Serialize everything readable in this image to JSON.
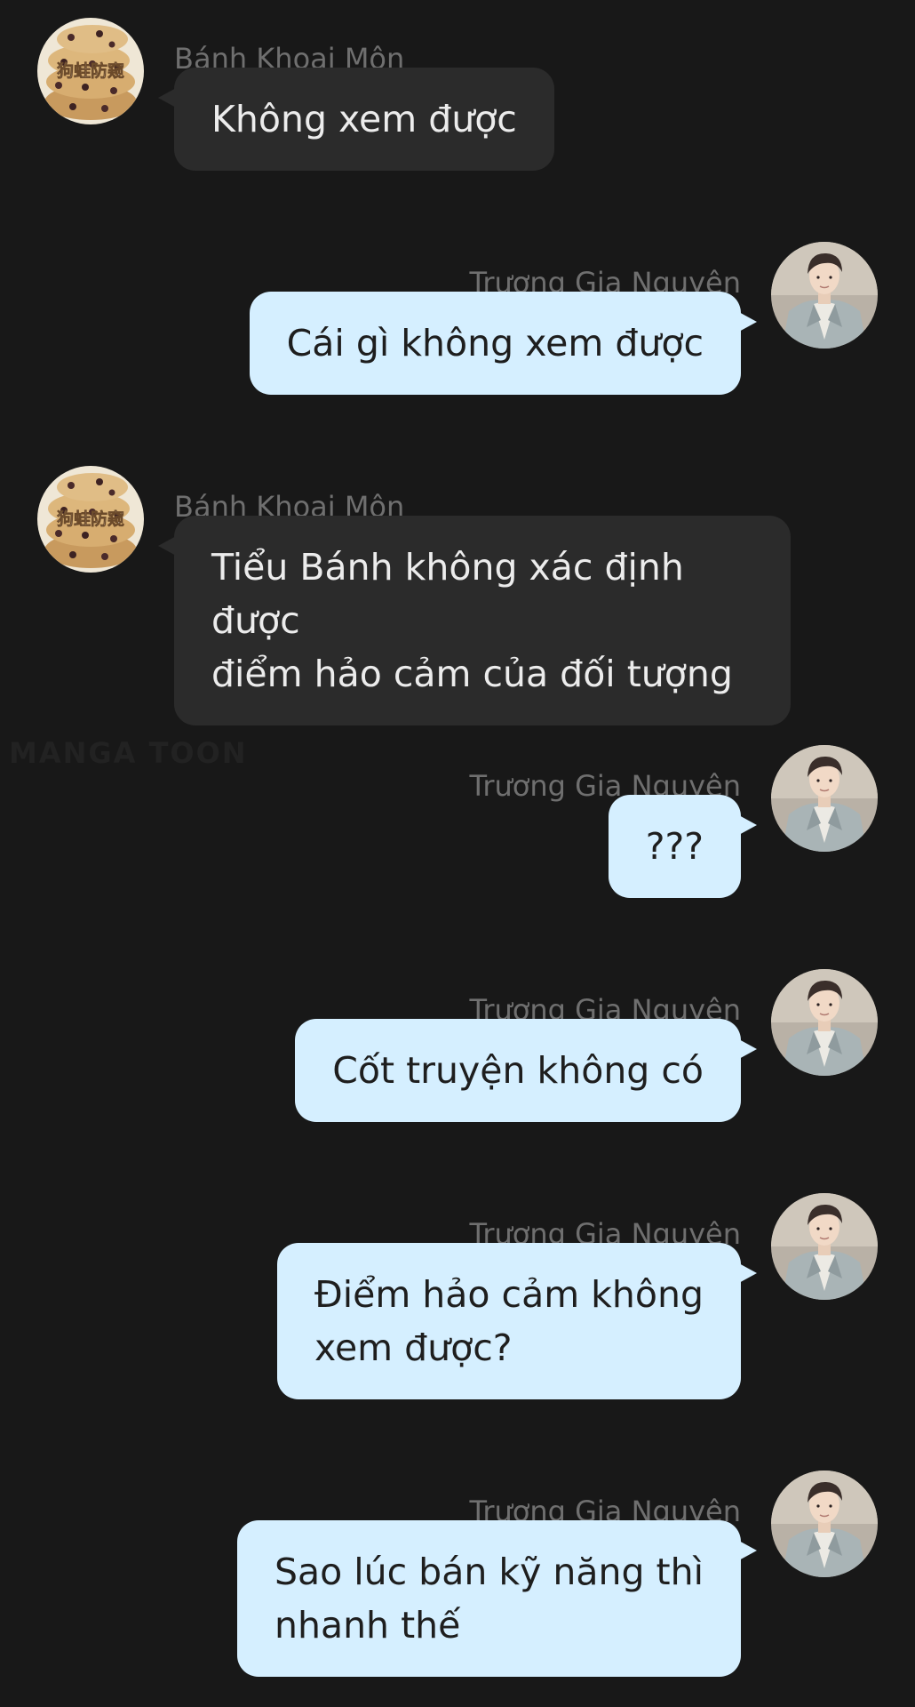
{
  "participants": {
    "left": {
      "name": "Bánh Khoai Môn",
      "avatar_icon": "cookie-stack-avatar"
    },
    "right": {
      "name": "Trương Gia Nguyên",
      "avatar_icon": "man-in-suit-avatar"
    }
  },
  "colors": {
    "background": "#181818",
    "left_bubble": "#2b2b2b",
    "right_bubble": "#d5efff",
    "sender_name": "#6f6f6f"
  },
  "avatar_text": "狗蛙防窥",
  "watermark": "MANGA TOON",
  "messages": [
    {
      "side": "left",
      "sender": "Bánh Khoai Môn",
      "text": "Không xem được"
    },
    {
      "side": "right",
      "sender": "Trương Gia Nguyên",
      "text": "Cái gì không xem được"
    },
    {
      "side": "left",
      "sender": "Bánh Khoai Môn",
      "text": "Tiểu Bánh không xác định được\nđiểm hảo cảm của đối tượng"
    },
    {
      "side": "right",
      "sender": "Trương Gia Nguyên",
      "text": "???"
    },
    {
      "side": "right",
      "sender": "Trương Gia Nguyên",
      "text": "Cốt truyện không có"
    },
    {
      "side": "right",
      "sender": "Trương Gia Nguyên",
      "text": "Điểm hảo cảm không\nxem được?"
    },
    {
      "side": "right",
      "sender": "Trương Gia Nguyên",
      "text": "Sao lúc bán kỹ năng thì\nnhanh thế"
    }
  ]
}
